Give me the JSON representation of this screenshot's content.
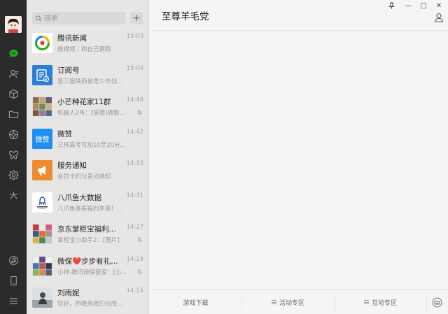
{
  "search": {
    "placeholder": "搜索"
  },
  "add_button": {
    "label": "+"
  },
  "chat": {
    "title": "至尊羊毛党"
  },
  "window_controls": {
    "pin": "⊥",
    "minimize": "—",
    "maximize": "□",
    "close": "✕"
  },
  "conversations": [
    {
      "title": "腾讯新闻",
      "time": "15:03",
      "message": "微视频｜和自己赛跑",
      "muted": false,
      "avatar": "tencent-news",
      "avatar_text": ""
    },
    {
      "title": "订阅号",
      "time": "15:04",
      "message": "第三届陕西省青少年创新...",
      "muted": false,
      "avatar": "subscription",
      "avatar_text": ""
    },
    {
      "title": "小芒种花家11群",
      "time": "14:48",
      "message": "机器人2号：[链接]微题...",
      "muted": true,
      "avatar": "group-grid",
      "avatar_text": ""
    },
    {
      "title": "微赞",
      "time": "14:42",
      "message": "三孩高考可加10至20分...",
      "muted": false,
      "avatar": "weizan",
      "avatar_text": "微赞"
    },
    {
      "title": "服务通知",
      "time": "14:33",
      "message": "会员卡积分变动通知",
      "muted": false,
      "avatar": "service",
      "avatar_text": ""
    },
    {
      "title": "八爪鱼大数据",
      "time": "14:31",
      "message": "八爪鱼喜春福利来袭！最...",
      "muted": false,
      "avatar": "octopus",
      "avatar_text": ""
    },
    {
      "title": "京东掌柜宝福利群15...",
      "time": "14:27",
      "message": "掌柜宝小助手2：[图片]",
      "muted": true,
      "avatar": "group-grid",
      "avatar_text": ""
    },
    {
      "title": "微保❤️步步有礼活动...",
      "time": "14:19",
      "message": "小祥-腾讯微保管家：[小...",
      "muted": true,
      "avatar": "group-grid",
      "avatar_text": ""
    },
    {
      "title": "刘雨妮",
      "time": "14:15",
      "message": "您好，所晚来我们仓库面...",
      "muted": false,
      "avatar": "person",
      "avatar_text": ""
    }
  ],
  "bottom_menu": [
    {
      "label": "游戏下载",
      "has_lines": false
    },
    {
      "label": "活动专区",
      "has_lines": true
    },
    {
      "label": "互动专区",
      "has_lines": true
    }
  ],
  "colors": {
    "rail": "#2b2b2d",
    "list_bg": "#e7e6e5",
    "active_item": "#d2d1d0",
    "accent_green": "#1aad19",
    "weizan_blue": "#1e8ef2",
    "service_orange": "#f08a2e"
  }
}
